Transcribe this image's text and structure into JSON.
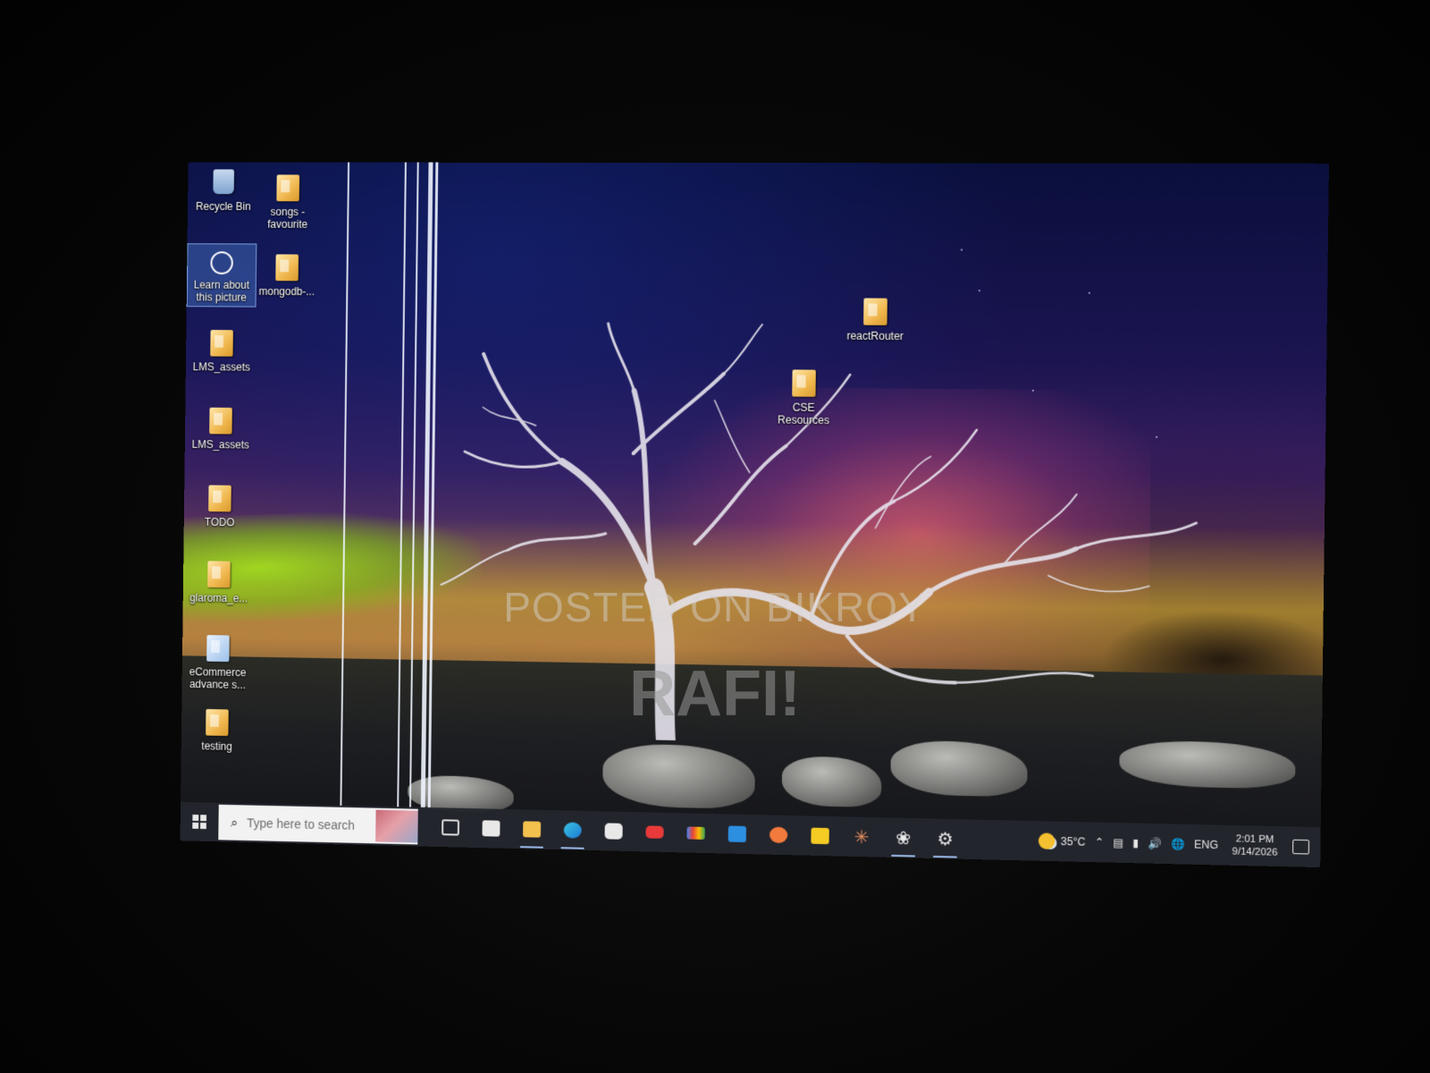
{
  "desktop": {
    "icons": [
      {
        "label": "Recycle Bin",
        "icon": "recycle-bin-icon"
      },
      {
        "label": "songs - favourite",
        "icon": "folder-icon"
      },
      {
        "label": "Learn about this picture",
        "icon": "learn-picture-icon"
      },
      {
        "label": "mongodb-...",
        "icon": "folder-icon"
      },
      {
        "label": "LMS_assets",
        "icon": "zip-folder-icon"
      },
      {
        "label": "LMS_assets",
        "icon": "folder-icon"
      },
      {
        "label": "TODO",
        "icon": "folder-icon"
      },
      {
        "label": "glaroma_e...",
        "icon": "folder-icon"
      },
      {
        "label": "eCommerce advance s...",
        "icon": "file-icon"
      },
      {
        "label": "testing",
        "icon": "folder-icon"
      },
      {
        "label": "reactRouter",
        "icon": "folder-icon"
      },
      {
        "label": "CSE Resources",
        "icon": "folder-icon"
      }
    ]
  },
  "taskbar": {
    "search_placeholder": "Type here to search",
    "apps": [
      {
        "name": "task-view-icon",
        "active": false
      },
      {
        "name": "store-icon",
        "active": false
      },
      {
        "name": "file-explorer-icon",
        "active": true
      },
      {
        "name": "edge-icon",
        "active": true
      },
      {
        "name": "app-icon",
        "active": false
      },
      {
        "name": "youtube-icon",
        "active": false
      },
      {
        "name": "gmail-icon",
        "active": false
      },
      {
        "name": "vscode-icon",
        "active": false
      },
      {
        "name": "postman-icon",
        "active": false
      },
      {
        "name": "sticky-notes-icon",
        "active": false
      },
      {
        "name": "claude-icon",
        "active": false
      },
      {
        "name": "chatgpt-icon",
        "active": true
      },
      {
        "name": "settings-icon",
        "active": true
      }
    ],
    "tray": {
      "temperature": "35°C",
      "language": "ENG",
      "time": "2:01 PM",
      "date": "9/14/2026"
    }
  },
  "watermark": {
    "line1": "POSTED ON BIKROY",
    "line2": "RAFI!"
  },
  "colors": {
    "taskbar_bg": "#24262e",
    "selection": "#4678c8",
    "sky_top": "#0a0f3c",
    "horizon_yellow": "#d7b928",
    "green_band": "#a0dc1e"
  }
}
